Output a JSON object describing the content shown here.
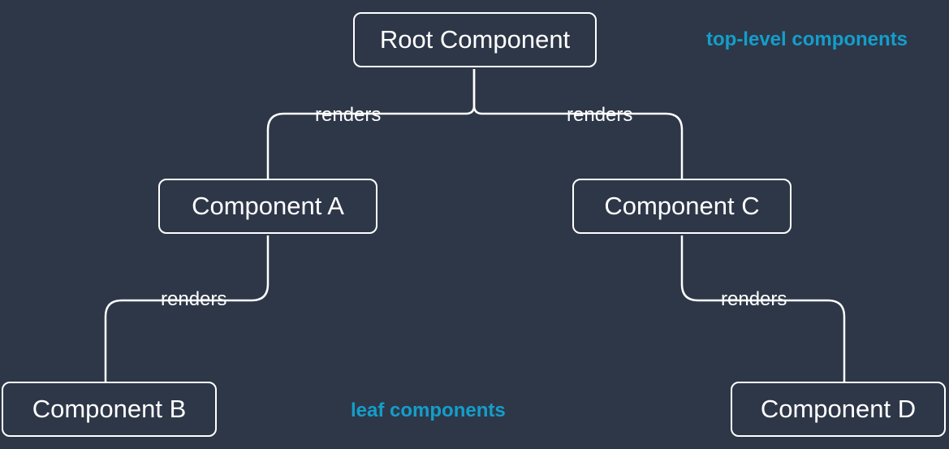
{
  "nodes": {
    "root": "Root Component",
    "a": "Component A",
    "b": "Component B",
    "c": "Component C",
    "d": "Component D"
  },
  "edges": {
    "root_to_a": "renders",
    "root_to_c": "renders",
    "a_to_b": "renders",
    "c_to_d": "renders"
  },
  "annotations": {
    "top_level": "top-level components",
    "leaf": "leaf components"
  },
  "colors": {
    "node_bg": "#2e3748",
    "node_border": "#ffffff",
    "text": "#ffffff",
    "accent": "#149eca"
  }
}
